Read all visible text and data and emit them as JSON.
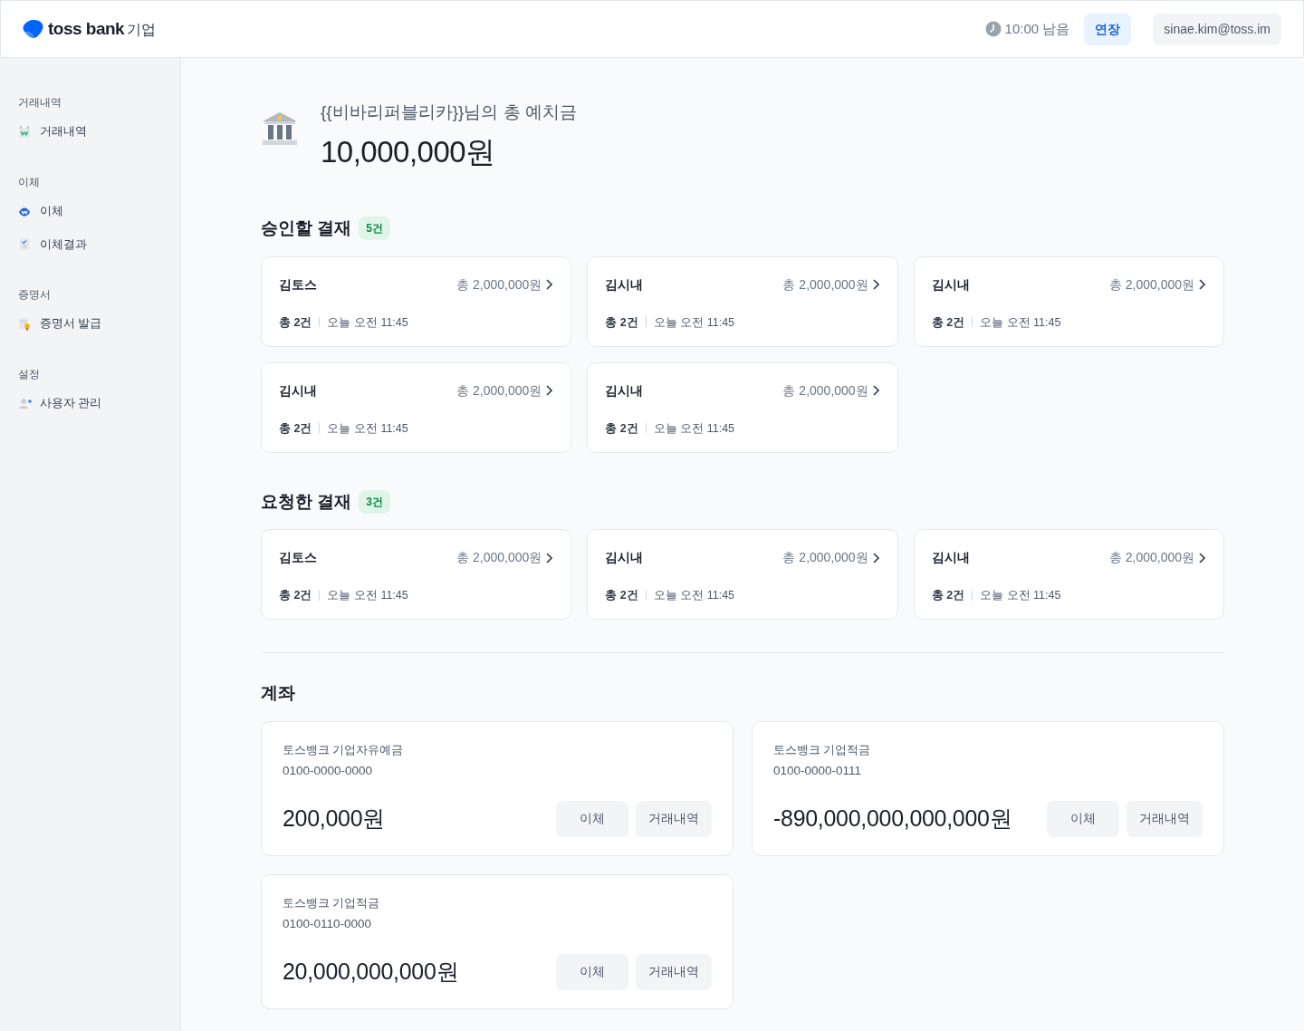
{
  "header": {
    "logo_text": "toss bank",
    "logo_suffix": "기업",
    "timer": "10:00 남음",
    "extend_button": "연장",
    "user_email": "sinae.kim@toss.im"
  },
  "sidebar": {
    "sections": [
      {
        "title": "거래내역",
        "items": [
          "거래내역"
        ]
      },
      {
        "title": "이체",
        "items": [
          "이체",
          "이체결과"
        ]
      },
      {
        "title": "증명서",
        "items": [
          "증명서 발급"
        ]
      },
      {
        "title": "설정",
        "items": [
          "사용자 관리"
        ]
      }
    ]
  },
  "summary": {
    "label": "{{비바리퍼블리카}}님의 총 예치금",
    "amount": "10,000,000원"
  },
  "payment_sections": [
    {
      "title": "승인할 결재",
      "count": "5건",
      "cards": [
        {
          "name": "김토스",
          "amount": "총 2,000,000원",
          "count": "총 2건",
          "time": "오늘 오전 11:45"
        },
        {
          "name": "김시내",
          "amount": "총 2,000,000원",
          "count": "총 2건",
          "time": "오늘 오전 11:45"
        },
        {
          "name": "김시내",
          "amount": "총 2,000,000원",
          "count": "총 2건",
          "time": "오늘 오전 11:45"
        },
        {
          "name": "김시내",
          "amount": "총 2,000,000원",
          "count": "총 2건",
          "time": "오늘 오전 11:45"
        },
        {
          "name": "김시내",
          "amount": "총 2,000,000원",
          "count": "총 2건",
          "time": "오늘 오전 11:45"
        }
      ]
    },
    {
      "title": "요청한 결재",
      "count": "3건",
      "cards": [
        {
          "name": "김토스",
          "amount": "총 2,000,000원",
          "count": "총 2건",
          "time": "오늘 오전 11:45"
        },
        {
          "name": "김시내",
          "amount": "총 2,000,000원",
          "count": "총 2건",
          "time": "오늘 오전 11:45"
        },
        {
          "name": "김시내",
          "amount": "총 2,000,000원",
          "count": "총 2건",
          "time": "오늘 오전 11:45"
        }
      ]
    }
  ],
  "accounts": {
    "title": "계좌",
    "items": [
      {
        "product": "토스뱅크 기업자유예금",
        "number": "0100-0000-0000",
        "balance": "200,000원",
        "buttons": [
          "이체",
          "거래내역"
        ]
      },
      {
        "product": "토스뱅크 기업적금",
        "number": "0100-0000-0111",
        "balance": "-890,000,000,000,000원",
        "buttons": [
          "이체",
          "거래내역"
        ]
      },
      {
        "product": "토스뱅크 기업적금",
        "number": "0100-0110-0000",
        "balance": "20,000,000,000원",
        "buttons": [
          "이체",
          "거래내역"
        ]
      }
    ]
  }
}
